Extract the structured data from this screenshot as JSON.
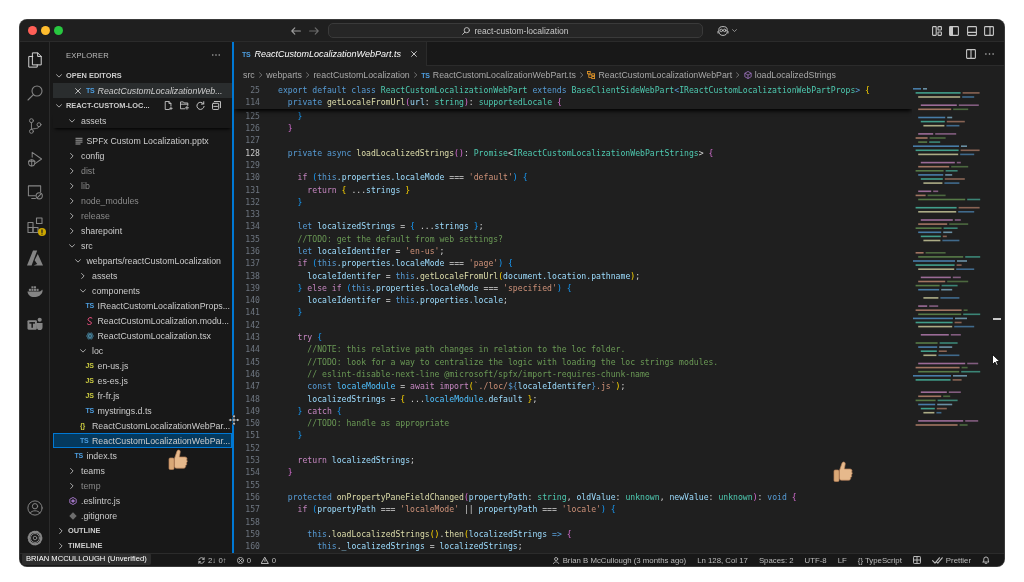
{
  "title_bar": {
    "command_center": {
      "label": "react-custom-localization"
    }
  },
  "activity_bar": {
    "items": [
      {
        "kind": "explorer",
        "selected": true,
        "warning": false
      },
      {
        "kind": "search",
        "selected": false,
        "warning": false
      },
      {
        "kind": "source-control",
        "selected": false,
        "warning": false
      },
      {
        "kind": "run-debug",
        "selected": false,
        "warning": false
      },
      {
        "kind": "remote",
        "selected": false,
        "warning": false
      },
      {
        "kind": "extensions",
        "selected": false,
        "warning": true
      },
      {
        "kind": "azure",
        "selected": false,
        "warning": false
      },
      {
        "kind": "docker",
        "selected": false,
        "warning": false
      },
      {
        "kind": "teams",
        "selected": false,
        "warning": false
      }
    ],
    "bottom": [
      {
        "kind": "account"
      },
      {
        "kind": "settings"
      }
    ]
  },
  "explorer": {
    "title": "EXPLORER",
    "open_editors": {
      "title": "OPEN EDITORS",
      "expanded": true,
      "items": [
        {
          "name": "ReactCustomLocalizationWeb...",
          "kind": "typescript",
          "badge": "TS",
          "selected": true,
          "preview": true
        }
      ]
    },
    "folder": {
      "title": "REACT-CUSTOM-LOC...",
      "expanded": true,
      "children": [
        {
          "name": "assets",
          "kind": "folder",
          "expanded": true,
          "selected": false,
          "ignored": false,
          "children": [
            {
              "name": "SPFx Custom Localization.pptx",
              "kind": "document",
              "selected": false,
              "ignored": false
            }
          ]
        },
        {
          "name": "config",
          "kind": "folder",
          "expanded": false,
          "selected": false,
          "ignored": false
        },
        {
          "name": "dist",
          "kind": "folder",
          "expanded": false,
          "selected": false,
          "ignored": true
        },
        {
          "name": "lib",
          "kind": "folder",
          "expanded": false,
          "selected": false,
          "ignored": true
        },
        {
          "name": "node_modules",
          "kind": "folder",
          "expanded": false,
          "selected": false,
          "ignored": true
        },
        {
          "name": "release",
          "kind": "folder",
          "expanded": false,
          "selected": false,
          "ignored": true
        },
        {
          "name": "sharepoint",
          "kind": "folder",
          "expanded": false,
          "selected": false,
          "ignored": false
        },
        {
          "name": "src",
          "kind": "folder",
          "expanded": true,
          "selected": false,
          "ignored": false,
          "children": [
            {
              "name": "webparts/reactCustomLocalization",
              "kind": "folder",
              "expanded": true,
              "selected": false,
              "ignored": false,
              "children": [
                {
                  "name": "assets",
                  "kind": "folder",
                  "expanded": false,
                  "selected": false,
                  "ignored": false
                },
                {
                  "name": "components",
                  "kind": "folder",
                  "expanded": true,
                  "selected": false,
                  "ignored": false,
                  "children": [
                    {
                      "name": "IReactCustomLocalizationProps...",
                      "kind": "typescript",
                      "badge": "TS",
                      "selected": false,
                      "ignored": false
                    },
                    {
                      "name": "ReactCustomLocalization.modu...",
                      "kind": "stylesheet",
                      "selected": false,
                      "ignored": false
                    },
                    {
                      "name": "ReactCustomLocalization.tsx",
                      "kind": "react",
                      "selected": false,
                      "ignored": false
                    }
                  ]
                },
                {
                  "name": "loc",
                  "kind": "folder",
                  "expanded": true,
                  "selected": false,
                  "ignored": false,
                  "children": [
                    {
                      "name": "en-us.js",
                      "kind": "javascript",
                      "badge": "JS",
                      "selected": false,
                      "ignored": false
                    },
                    {
                      "name": "es-es.js",
                      "kind": "javascript",
                      "badge": "JS",
                      "selected": false,
                      "ignored": false
                    },
                    {
                      "name": "fr-fr.js",
                      "kind": "javascript",
                      "badge": "JS",
                      "selected": false,
                      "ignored": false
                    },
                    {
                      "name": "mystrings.d.ts",
                      "kind": "typescript",
                      "badge": "TS",
                      "selected": false,
                      "ignored": false
                    }
                  ]
                },
                {
                  "name": "ReactCustomLocalizationWebPar...",
                  "kind": "json",
                  "badge": "{}",
                  "selected": false,
                  "ignored": false
                },
                {
                  "name": "ReactCustomLocalizationWebPar...",
                  "kind": "typescript",
                  "badge": "TS",
                  "selected": true,
                  "ignored": false
                }
              ]
            },
            {
              "name": "index.ts",
              "kind": "typescript",
              "badge": "TS",
              "selected": false,
              "ignored": false
            }
          ]
        },
        {
          "name": "teams",
          "kind": "folder",
          "expanded": false,
          "selected": false,
          "ignored": false
        },
        {
          "name": "temp",
          "kind": "folder",
          "expanded": false,
          "selected": false,
          "ignored": true
        },
        {
          "name": ".eslintrc.js",
          "kind": "eslint",
          "selected": false,
          "ignored": false
        },
        {
          "name": ".gitignore",
          "kind": "git",
          "selected": false,
          "ignored": false
        }
      ]
    },
    "sections": [
      {
        "title": "OUTLINE",
        "expanded": false
      },
      {
        "title": "TIMELINE",
        "expanded": false
      }
    ]
  },
  "editor": {
    "tabs": [
      {
        "label": "ReactCustomLocalizationWebPart.ts",
        "kind": "typescript",
        "badge": "TS",
        "selected": true,
        "preview": true
      }
    ],
    "breadcrumbs": [
      {
        "label": "src",
        "kind": "folder"
      },
      {
        "label": "webparts",
        "kind": "folder"
      },
      {
        "label": "reactCustomLocalization",
        "kind": "folder"
      },
      {
        "label": "ReactCustomLocalizationWebPart.ts",
        "kind": "typescript",
        "badge": "TS"
      },
      {
        "label": "ReactCustomLocalizationWebPart",
        "kind": "class"
      },
      {
        "label": "loadLocalizedStrings",
        "kind": "method"
      }
    ],
    "sticky_lines": [
      {
        "number": "25",
        "tokens": [
          {
            "text": "export default class ",
            "kind": "keyword"
          },
          {
            "text": "ReactCustomLocalizationWebPart ",
            "kind": "type"
          },
          {
            "text": "extends ",
            "kind": "keyword"
          },
          {
            "text": "BaseClientSideWebPart",
            "kind": "type"
          },
          {
            "text": "<",
            "kind": "keyword"
          },
          {
            "text": "IReactCustomLocalizationWebPartProps",
            "kind": "type"
          },
          {
            "text": "> ",
            "kind": "keyword"
          },
          {
            "text": "{",
            "kind": "bracket1"
          }
        ]
      },
      {
        "number": "114",
        "tokens": [
          {
            "text": "  private ",
            "kind": "keyword"
          },
          {
            "text": "getLocaleFromUrl",
            "kind": "function"
          },
          {
            "text": "(",
            "kind": "bracket2"
          },
          {
            "text": "url",
            "kind": "variable"
          },
          {
            "text": ": ",
            "kind": "plain"
          },
          {
            "text": "string",
            "kind": "type"
          },
          {
            "text": ")",
            "kind": "bracket2"
          },
          {
            "text": ": ",
            "kind": "plain"
          },
          {
            "text": "supportedLocale ",
            "kind": "type"
          },
          {
            "text": "{",
            "kind": "bracket2"
          }
        ]
      }
    ],
    "lines": [
      {
        "number": "125",
        "active": false,
        "tokens": [
          {
            "text": "    }",
            "kind": "bracket3"
          }
        ]
      },
      {
        "number": "126",
        "active": false,
        "tokens": [
          {
            "text": "  }",
            "kind": "bracket2"
          }
        ]
      },
      {
        "number": "127",
        "active": false
      },
      {
        "number": "128",
        "active": true,
        "tokens": [
          {
            "text": "  private async ",
            "kind": "keyword"
          },
          {
            "text": "loadLocalizedStrings",
            "kind": "function"
          },
          {
            "text": "()",
            "kind": "bracket2"
          },
          {
            "text": ": ",
            "kind": "plain"
          },
          {
            "text": "Promise",
            "kind": "type"
          },
          {
            "text": "<",
            "kind": "plain"
          },
          {
            "text": "IReactCustomLocalizationWebPartStrings",
            "kind": "type"
          },
          {
            "text": "> ",
            "kind": "plain"
          },
          {
            "text": "{",
            "kind": "bracket2"
          }
        ]
      },
      {
        "number": "129",
        "active": false
      },
      {
        "number": "130",
        "active": false,
        "tokens": [
          {
            "text": "    if ",
            "kind": "control"
          },
          {
            "text": "(",
            "kind": "bracket3"
          },
          {
            "text": "this",
            "kind": "keyword"
          },
          {
            "text": ".properties.localeMode ",
            "kind": "variable"
          },
          {
            "text": "=== ",
            "kind": "plain"
          },
          {
            "text": "'default'",
            "kind": "string"
          },
          {
            "text": ") ",
            "kind": "bracket3"
          },
          {
            "text": "{",
            "kind": "bracket3"
          }
        ]
      },
      {
        "number": "131",
        "active": false,
        "tokens": [
          {
            "text": "      return ",
            "kind": "control"
          },
          {
            "text": "{ ",
            "kind": "bracket1"
          },
          {
            "text": "...",
            "kind": "plain"
          },
          {
            "text": "strings ",
            "kind": "variable"
          },
          {
            "text": "}",
            "kind": "bracket1"
          }
        ]
      },
      {
        "number": "132",
        "active": false,
        "tokens": [
          {
            "text": "    }",
            "kind": "bracket3"
          }
        ]
      },
      {
        "number": "133",
        "active": false
      },
      {
        "number": "134",
        "active": false,
        "tokens": [
          {
            "text": "    let ",
            "kind": "keyword"
          },
          {
            "text": "localizedStrings ",
            "kind": "variable"
          },
          {
            "text": "= ",
            "kind": "plain"
          },
          {
            "text": "{ ",
            "kind": "bracket3"
          },
          {
            "text": "...",
            "kind": "plain"
          },
          {
            "text": "strings ",
            "kind": "variable"
          },
          {
            "text": "}",
            "kind": "bracket3"
          },
          {
            "text": ";",
            "kind": "plain"
          }
        ]
      },
      {
        "number": "135",
        "active": false,
        "tokens": [
          {
            "text": "    //TODO: get the default from web settings?",
            "kind": "comment"
          }
        ]
      },
      {
        "number": "136",
        "active": false,
        "tokens": [
          {
            "text": "    let ",
            "kind": "keyword"
          },
          {
            "text": "localeIdentifer ",
            "kind": "variable"
          },
          {
            "text": "= ",
            "kind": "plain"
          },
          {
            "text": "'en-us'",
            "kind": "string"
          },
          {
            "text": ";",
            "kind": "plain"
          }
        ]
      },
      {
        "number": "137",
        "active": false,
        "tokens": [
          {
            "text": "    if ",
            "kind": "control"
          },
          {
            "text": "(",
            "kind": "bracket3"
          },
          {
            "text": "this",
            "kind": "keyword"
          },
          {
            "text": ".properties.localeMode ",
            "kind": "variable"
          },
          {
            "text": "=== ",
            "kind": "plain"
          },
          {
            "text": "'page'",
            "kind": "string"
          },
          {
            "text": ") ",
            "kind": "bracket3"
          },
          {
            "text": "{",
            "kind": "bracket3"
          }
        ]
      },
      {
        "number": "138",
        "active": false,
        "tokens": [
          {
            "text": "      localeIdentifer ",
            "kind": "variable"
          },
          {
            "text": "= ",
            "kind": "plain"
          },
          {
            "text": "this",
            "kind": "keyword"
          },
          {
            "text": ".",
            "kind": "plain"
          },
          {
            "text": "getLocaleFromUrl",
            "kind": "function"
          },
          {
            "text": "(",
            "kind": "bracket1"
          },
          {
            "text": "document.location.pathname",
            "kind": "variable"
          },
          {
            "text": ")",
            "kind": "bracket1"
          },
          {
            "text": ";",
            "kind": "plain"
          }
        ]
      },
      {
        "number": "139",
        "active": false,
        "tokens": [
          {
            "text": "    } ",
            "kind": "bracket3"
          },
          {
            "text": "else if ",
            "kind": "control"
          },
          {
            "text": "(",
            "kind": "bracket3"
          },
          {
            "text": "this",
            "kind": "keyword"
          },
          {
            "text": ".properties.localeMode ",
            "kind": "variable"
          },
          {
            "text": "=== ",
            "kind": "plain"
          },
          {
            "text": "'specified'",
            "kind": "string"
          },
          {
            "text": ") ",
            "kind": "bracket3"
          },
          {
            "text": "{",
            "kind": "bracket3"
          }
        ]
      },
      {
        "number": "140",
        "active": false,
        "tokens": [
          {
            "text": "      localeIdentifer ",
            "kind": "variable"
          },
          {
            "text": "= ",
            "kind": "plain"
          },
          {
            "text": "this",
            "kind": "keyword"
          },
          {
            "text": ".properties.locale",
            "kind": "variable"
          },
          {
            "text": ";",
            "kind": "plain"
          }
        ]
      },
      {
        "number": "141",
        "active": false,
        "tokens": [
          {
            "text": "    }",
            "kind": "bracket3"
          }
        ]
      },
      {
        "number": "142",
        "active": false
      },
      {
        "number": "143",
        "active": false,
        "tokens": [
          {
            "text": "    try ",
            "kind": "control"
          },
          {
            "text": "{",
            "kind": "bracket3"
          }
        ]
      },
      {
        "number": "144",
        "active": false,
        "tokens": [
          {
            "text": "      //NOTE: this relative path changes in relation to the loc folder.",
            "kind": "comment"
          }
        ]
      },
      {
        "number": "145",
        "active": false,
        "tokens": [
          {
            "text": "      //TODO: look for a way to centralize the logic with loading the loc strings modules.",
            "kind": "comment"
          }
        ]
      },
      {
        "number": "146",
        "active": false,
        "tokens": [
          {
            "text": "      // eslint-disable-next-line @microsoft/spfx/import-requires-chunk-name",
            "kind": "comment"
          }
        ]
      },
      {
        "number": "147",
        "active": false,
        "tokens": [
          {
            "text": "      const ",
            "kind": "keyword"
          },
          {
            "text": "localeModule ",
            "kind": "constant"
          },
          {
            "text": "= ",
            "kind": "plain"
          },
          {
            "text": "await import",
            "kind": "control"
          },
          {
            "text": "(",
            "kind": "bracket1"
          },
          {
            "text": "`./loc/",
            "kind": "string"
          },
          {
            "text": "${",
            "kind": "keyword"
          },
          {
            "text": "localeIdentifer",
            "kind": "variable"
          },
          {
            "text": "}",
            "kind": "keyword"
          },
          {
            "text": ".js`",
            "kind": "string"
          },
          {
            "text": ")",
            "kind": "bracket1"
          },
          {
            "text": ";",
            "kind": "plain"
          }
        ]
      },
      {
        "number": "148",
        "active": false,
        "tokens": [
          {
            "text": "      localizedStrings ",
            "kind": "variable"
          },
          {
            "text": "= ",
            "kind": "plain"
          },
          {
            "text": "{ ",
            "kind": "bracket1"
          },
          {
            "text": "...",
            "kind": "plain"
          },
          {
            "text": "localeModule",
            "kind": "constant"
          },
          {
            "text": ".default ",
            "kind": "variable"
          },
          {
            "text": "}",
            "kind": "bracket1"
          },
          {
            "text": ";",
            "kind": "plain"
          }
        ]
      },
      {
        "number": "149",
        "active": false,
        "tokens": [
          {
            "text": "    } ",
            "kind": "bracket3"
          },
          {
            "text": "catch ",
            "kind": "control"
          },
          {
            "text": "{",
            "kind": "bracket3"
          }
        ]
      },
      {
        "number": "150",
        "active": false,
        "tokens": [
          {
            "text": "      //TODO: handle as appropriate",
            "kind": "comment"
          }
        ]
      },
      {
        "number": "151",
        "active": false,
        "tokens": [
          {
            "text": "    }",
            "kind": "bracket3"
          }
        ]
      },
      {
        "number": "152",
        "active": false
      },
      {
        "number": "153",
        "active": false,
        "tokens": [
          {
            "text": "    return ",
            "kind": "control"
          },
          {
            "text": "localizedStrings",
            "kind": "variable"
          },
          {
            "text": ";",
            "kind": "plain"
          }
        ]
      },
      {
        "number": "154",
        "active": false,
        "tokens": [
          {
            "text": "  }",
            "kind": "bracket2"
          }
        ]
      },
      {
        "number": "155",
        "active": false
      },
      {
        "number": "156",
        "active": false,
        "tokens": [
          {
            "text": "  protected ",
            "kind": "keyword"
          },
          {
            "text": "onPropertyPaneFieldChanged",
            "kind": "function"
          },
          {
            "text": "(",
            "kind": "bracket2"
          },
          {
            "text": "propertyPath",
            "kind": "variable"
          },
          {
            "text": ": ",
            "kind": "plain"
          },
          {
            "text": "string",
            "kind": "type"
          },
          {
            "text": ", ",
            "kind": "plain"
          },
          {
            "text": "oldValue",
            "kind": "variable"
          },
          {
            "text": ": ",
            "kind": "plain"
          },
          {
            "text": "unknown",
            "kind": "type"
          },
          {
            "text": ", ",
            "kind": "plain"
          },
          {
            "text": "newValue",
            "kind": "variable"
          },
          {
            "text": ": ",
            "kind": "plain"
          },
          {
            "text": "unknown",
            "kind": "type"
          },
          {
            "text": ")",
            "kind": "bracket2"
          },
          {
            "text": ": ",
            "kind": "plain"
          },
          {
            "text": "void ",
            "kind": "keyword"
          },
          {
            "text": "{",
            "kind": "bracket2"
          }
        ]
      },
      {
        "number": "157",
        "active": false,
        "tokens": [
          {
            "text": "    if ",
            "kind": "control"
          },
          {
            "text": "(",
            "kind": "bracket3"
          },
          {
            "text": "propertyPath ",
            "kind": "variable"
          },
          {
            "text": "=== ",
            "kind": "plain"
          },
          {
            "text": "'localeMode' ",
            "kind": "string"
          },
          {
            "text": "|| ",
            "kind": "plain"
          },
          {
            "text": "propertyPath ",
            "kind": "variable"
          },
          {
            "text": "=== ",
            "kind": "plain"
          },
          {
            "text": "'locale'",
            "kind": "string"
          },
          {
            "text": ") ",
            "kind": "bracket3"
          },
          {
            "text": "{",
            "kind": "bracket3"
          }
        ]
      },
      {
        "number": "158",
        "active": false
      },
      {
        "number": "159",
        "active": false,
        "tokens": [
          {
            "text": "      this",
            "kind": "keyword"
          },
          {
            "text": ".",
            "kind": "plain"
          },
          {
            "text": "loadLocalizedStrings",
            "kind": "function"
          },
          {
            "text": "()",
            "kind": "bracket1"
          },
          {
            "text": ".",
            "kind": "plain"
          },
          {
            "text": "then",
            "kind": "function"
          },
          {
            "text": "(",
            "kind": "bracket1"
          },
          {
            "text": "localizedStrings ",
            "kind": "variable"
          },
          {
            "text": "=> ",
            "kind": "keyword"
          },
          {
            "text": "{",
            "kind": "bracket2"
          }
        ]
      },
      {
        "number": "160",
        "active": false,
        "tokens": [
          {
            "text": "        this",
            "kind": "keyword"
          },
          {
            "text": ".",
            "kind": "plain"
          },
          {
            "text": "_localizedStrings ",
            "kind": "variable"
          },
          {
            "text": "= ",
            "kind": "plain"
          },
          {
            "text": "localizedStrings",
            "kind": "variable"
          },
          {
            "text": ";",
            "kind": "plain"
          }
        ]
      }
    ]
  },
  "status_bar": {
    "left": [
      {
        "kind": "sync",
        "text": "2↓ 0↑"
      },
      {
        "kind": "errors",
        "text": "0"
      },
      {
        "kind": "warnings",
        "text": "0"
      }
    ],
    "right": [
      {
        "kind": "blame",
        "text": "Brian B McCullough (3 months ago)"
      },
      {
        "kind": "text",
        "text": "Ln 128, Col 17"
      },
      {
        "kind": "text",
        "text": "Spaces: 2"
      },
      {
        "kind": "text",
        "text": "UTF-8"
      },
      {
        "kind": "text",
        "text": "LF"
      },
      {
        "kind": "language",
        "text": "{} TypeScript"
      },
      {
        "kind": "layout"
      },
      {
        "kind": "prettier",
        "text": "Prettier"
      },
      {
        "kind": "notifications"
      }
    ]
  },
  "overlays": {
    "name_tag": "BRIAN MCCULLOUGH (Unverified)",
    "reactions": [
      {
        "kind": "thumbs-up"
      },
      {
        "kind": "thumbs-up"
      }
    ]
  }
}
